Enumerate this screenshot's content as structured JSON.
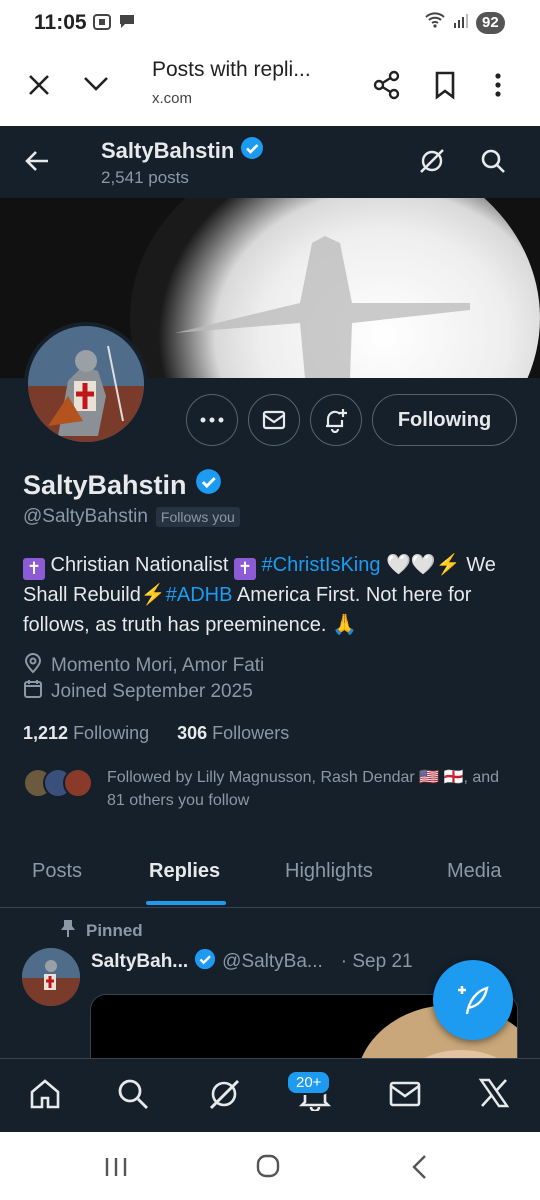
{
  "status_bar": {
    "time": "11:05",
    "battery": "92"
  },
  "browser": {
    "title": "Posts with repli...",
    "url": "x.com"
  },
  "header": {
    "name": "SaltyBahstin",
    "post_count": "2,541 posts"
  },
  "profile": {
    "display_name": "SaltyBahstin",
    "handle": "@SaltyBahstin",
    "follows_you": "Follows you",
    "follow_button": "Following",
    "bio_part1": " Christian Nationalist ",
    "bio_hashtag1": "#ChristIsKing",
    "bio_part2": " 🤍🤍⚡ We Shall Rebuild⚡",
    "bio_hashtag2": "#ADHB",
    "bio_part3": " America First. Not here for follows, as truth has preeminence. 🙏",
    "location": "Momento Mori, Amor Fati",
    "joined": "Joined September 2025",
    "following_count": "1,212",
    "following_label": "Following",
    "followers_count": "306",
    "followers_label": "Followers",
    "followed_by": "Followed by Lilly Magnusson, Rash Dendar 🇺🇸 🏴󠁧󠁢󠁥󠁮󠁧󠁿, and 81 others you follow"
  },
  "tabs": [
    "Posts",
    "Replies",
    "Highlights",
    "Media"
  ],
  "pinned_post": {
    "pinned_label": "Pinned",
    "name": "SaltyBah...",
    "handle": "@SaltyBa...",
    "date": "· Sep 21"
  },
  "notification_badge": "20+",
  "colors": {
    "background": "#15202b",
    "accent": "#1d9bf0",
    "text": "#e7e9ea",
    "muted": "#8b98a5"
  }
}
